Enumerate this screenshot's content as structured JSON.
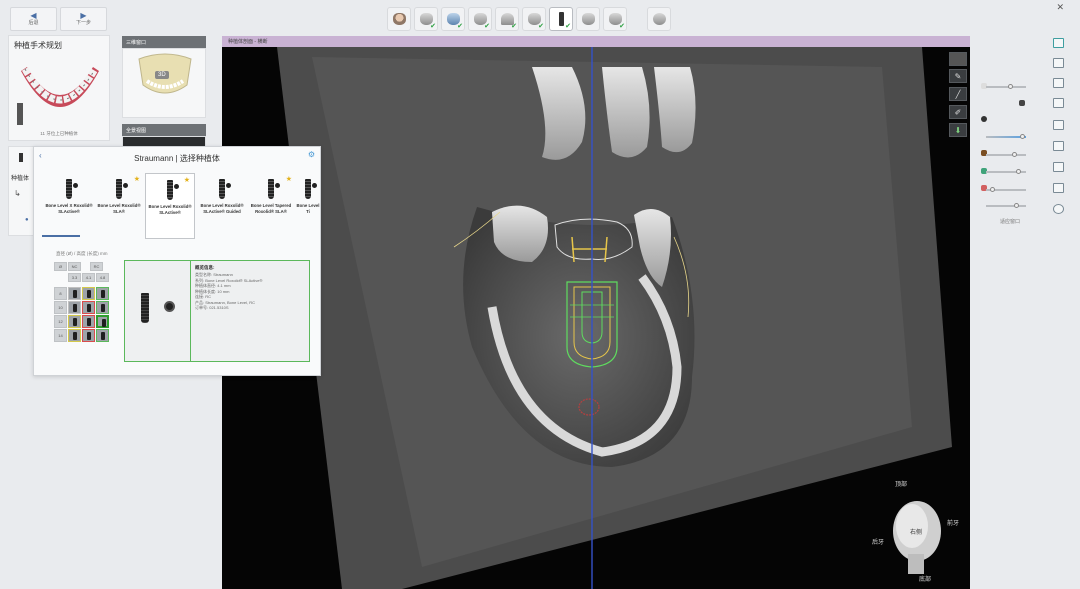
{
  "nav": {
    "back_label": "后退",
    "forward_label": "下一步"
  },
  "sidebar": {
    "plan_title": "种植手术规划",
    "plan_caption": "11 牙位上已种植体",
    "panel2_title": "三维窗口",
    "panel3_title": "全景视图",
    "model_badge": "3D",
    "implant_label": "种植体"
  },
  "viewport": {
    "title": "种植体剖面 - 横断",
    "orientation": {
      "top": "顶部",
      "front": "前牙",
      "back": "后牙",
      "bottom": "底部",
      "side": "右侧"
    }
  },
  "dialog": {
    "title": "Straumann | 选择种植体",
    "implants": [
      {
        "name": "Bone Level X Roxolid® SLActive®",
        "star": false,
        "selected": false
      },
      {
        "name": "Bone Level Roxolid® SLA®",
        "star": true,
        "selected": false
      },
      {
        "name": "Bone Level Roxolid® SLActive®",
        "star": true,
        "selected": true
      },
      {
        "name": "Bone Level Roxolid® SLActive® Guided",
        "star": false,
        "selected": false
      },
      {
        "name": "Bone Level Tapered Roxolid® SLA®",
        "star": true,
        "selected": false
      },
      {
        "name": "Bone Level Ti",
        "star": false,
        "selected": false
      }
    ],
    "size_caption": "直径 (Ø) / 高度 (长度) mm",
    "grid_cols": [
      "Ø",
      "NC",
      "RC"
    ],
    "grid_subcols": [
      "3.3",
      "4.1",
      "4.8"
    ],
    "grid_rows": [
      "8",
      "10",
      "12",
      "14"
    ],
    "detail": {
      "title": "概览信息:",
      "lines": [
        "类型名称: Straumann",
        "系列: Bone Level Roxolid® SLActive®",
        "种植体直径: 4.1 mm",
        "种植体长度: 10 mm",
        "连接: RC",
        "产品: Straumann, Bone Level, RC",
        "订单号: 021.5310S"
      ]
    }
  },
  "colors": {
    "accent": "#4a6fa5",
    "viewport_title_bg": "#c9b2d3",
    "implant_green": "#5fdc5f",
    "tooth_outline_yellow": "#e6c54a"
  },
  "right_panel": {
    "zoom_label": "适应窗口"
  }
}
